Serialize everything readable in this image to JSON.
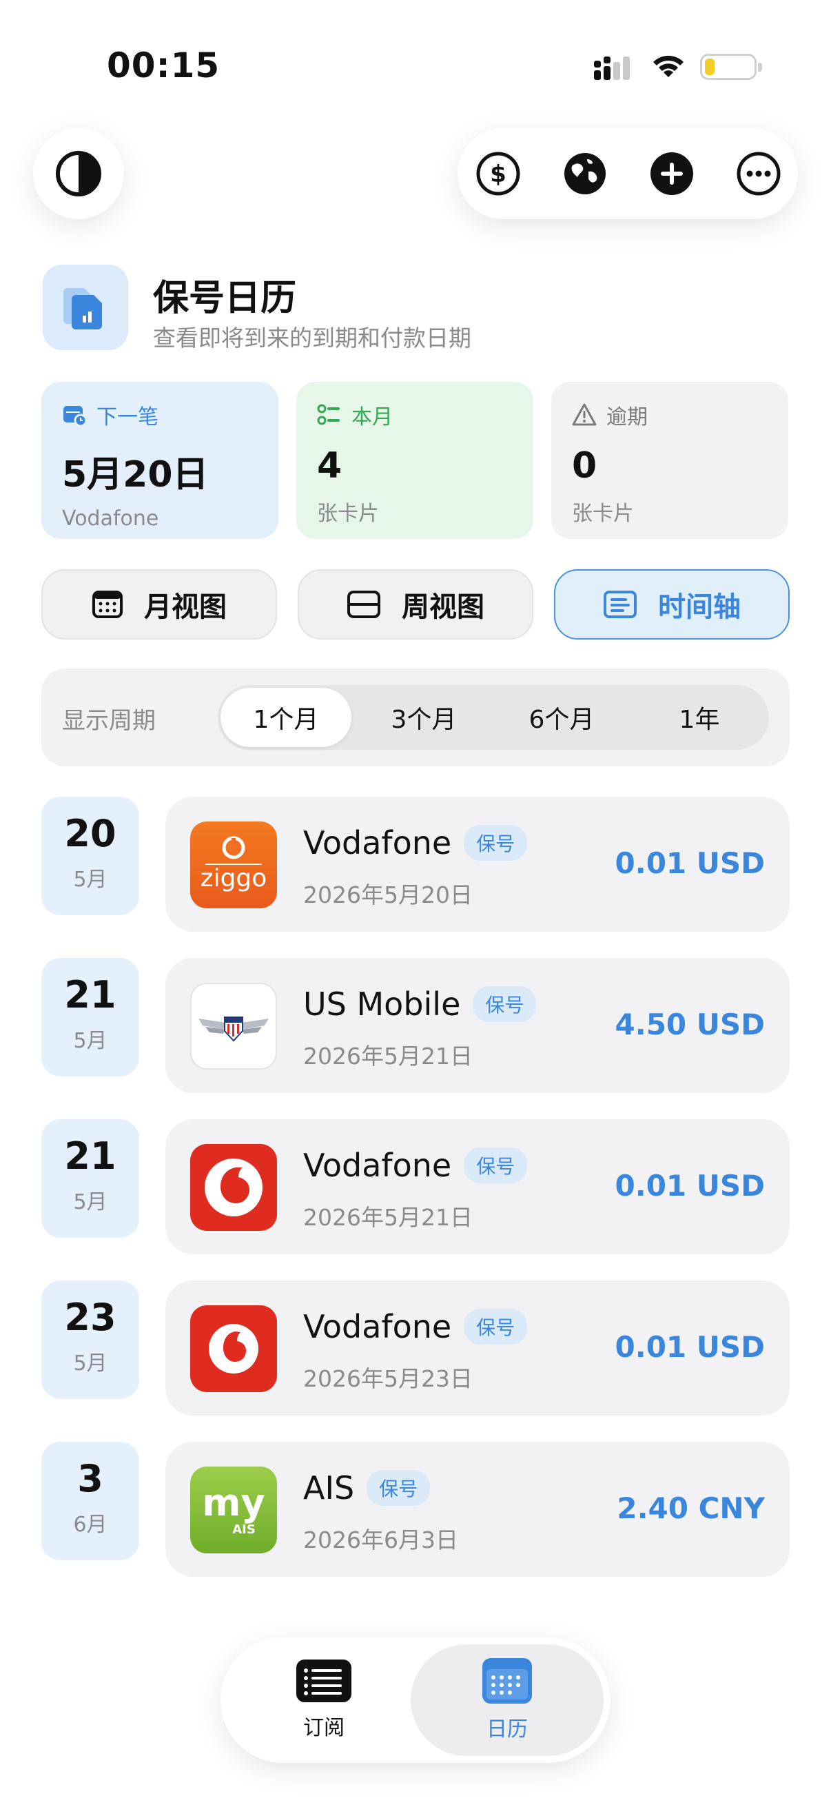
{
  "status_bar": {
    "time": "00:15"
  },
  "header": {
    "title": "保号日历",
    "subtitle": "查看即将到来的到期和付款日期"
  },
  "stats": [
    {
      "label": "下一笔",
      "value": "5月20日",
      "sub": "Vodafone",
      "accent": "#3a86dc",
      "bg": "#e3effb"
    },
    {
      "label": "本月",
      "value": "4",
      "sub": "张卡片",
      "accent": "#34a853",
      "bg": "#e6f6e8"
    },
    {
      "label": "逾期",
      "value": "0",
      "sub": "张卡片",
      "accent": "#7a7a7e",
      "bg": "#f2f2f4"
    }
  ],
  "views": [
    {
      "label": "月视图",
      "icon": "calendar-icon"
    },
    {
      "label": "周视图",
      "icon": "week-icon"
    },
    {
      "label": "时间轴",
      "icon": "timeline-icon",
      "active": true
    }
  ],
  "period": {
    "label": "显示周期",
    "options": [
      "1个月",
      "3个月",
      "6个月",
      "1年"
    ],
    "selected": "1个月"
  },
  "timeline": [
    {
      "day": "20",
      "month": "5月",
      "name": "Vodafone",
      "badge": "保号",
      "date": "2026年5月20日",
      "amount": "0.01 USD",
      "logo": "ziggo-logo",
      "logo_text": "ziggo"
    },
    {
      "day": "21",
      "month": "5月",
      "name": "US Mobile",
      "badge": "保号",
      "date": "2026年5月21日",
      "amount": "4.50 USD",
      "logo": "us-mobile-logo"
    },
    {
      "day": "21",
      "month": "5月",
      "name": "Vodafone",
      "badge": "保号",
      "date": "2026年5月21日",
      "amount": "0.01 USD",
      "logo": "vodafone-logo"
    },
    {
      "day": "23",
      "month": "5月",
      "name": "Vodafone",
      "badge": "保号",
      "date": "2026年5月23日",
      "amount": "0.01 USD",
      "logo": "vodafone-logo"
    },
    {
      "day": "3",
      "month": "6月",
      "name": "AIS",
      "badge": "保号",
      "date": "2026年6月3日",
      "amount": "2.40 CNY",
      "logo": "ais-logo",
      "logo_text": "my",
      "logo_subtext": "AIS"
    }
  ],
  "tabs": [
    {
      "label": "订阅",
      "icon": "list-icon"
    },
    {
      "label": "日历",
      "icon": "calendar-icon",
      "active": true
    }
  ],
  "colors": {
    "accent": "#3a86dc",
    "vodafone_red": "#e02b20",
    "ziggo_orange": "#f06a1e",
    "ais_green": "#8cc63f"
  }
}
